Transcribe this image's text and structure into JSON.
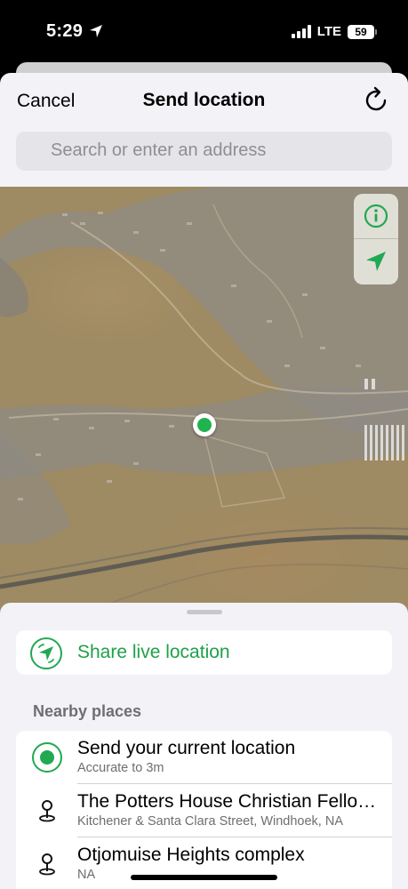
{
  "status_bar": {
    "time": "5:29",
    "network": "LTE",
    "battery": "59"
  },
  "nav": {
    "cancel_label": "Cancel",
    "title": "Send location"
  },
  "search": {
    "placeholder": "Search or enter an address"
  },
  "map": {
    "type": "satellite",
    "pin_color": "#21b34f"
  },
  "share_live": {
    "label": "Share live location"
  },
  "nearby": {
    "title": "Nearby places",
    "items": [
      {
        "title": "Send your current location",
        "subtitle": "Accurate to 3m",
        "icon": "current-location-icon"
      },
      {
        "title": "The Potters House Christian Fellowship",
        "subtitle": "Kitchener & Santa Clara Street, Windhoek, NA",
        "icon": "place-pin-icon"
      },
      {
        "title": "Otjomuise Heights complex",
        "subtitle": "NA",
        "icon": "place-pin-icon"
      }
    ]
  },
  "colors": {
    "accent": "#21a852",
    "background": "#f2f2f7"
  }
}
